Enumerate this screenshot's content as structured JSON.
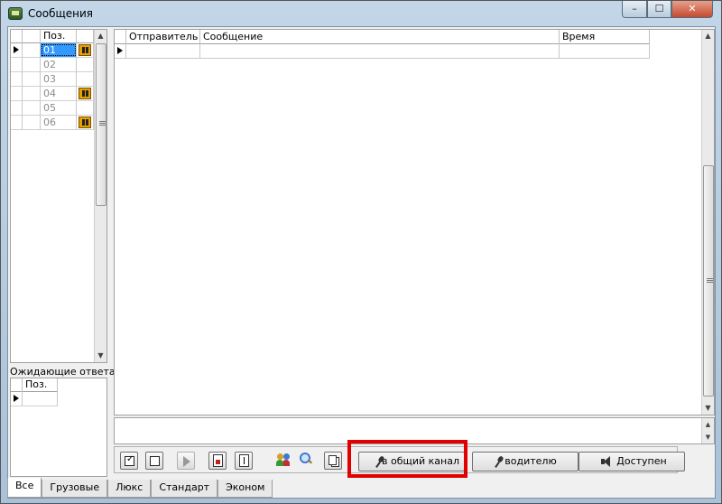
{
  "window": {
    "title": "Сообщения",
    "minimize_glyph": "–",
    "maximize_glyph": "☐",
    "close_glyph": "✕"
  },
  "positions_grid": {
    "header": "Поз.",
    "rows": [
      {
        "pos": "01",
        "selected": true,
        "icon": "pause-icon"
      },
      {
        "pos": "02",
        "selected": false,
        "icon": null
      },
      {
        "pos": "03",
        "selected": false,
        "icon": null
      },
      {
        "pos": "04",
        "selected": false,
        "icon": "pause-icon"
      },
      {
        "pos": "05",
        "selected": false,
        "icon": null
      },
      {
        "pos": "06",
        "selected": false,
        "icon": "pause-icon"
      }
    ]
  },
  "waiting": {
    "label": "Ожидающие ответа:",
    "header": "Поз."
  },
  "messages_grid": {
    "columns": [
      "Отправитель",
      "Сообщение",
      "Время"
    ]
  },
  "toolbar": {
    "broadcast_label": "в общий канал",
    "driver_label": "водителю",
    "available_label": "Доступен"
  },
  "tabs": [
    "Все",
    "Грузовые",
    "Люкс",
    "Стандарт",
    "Эконом"
  ],
  "active_tab": "Все",
  "colors": {
    "selection": "#3399ff",
    "pause_icon": "#e8a000",
    "highlight": "#e00000"
  }
}
